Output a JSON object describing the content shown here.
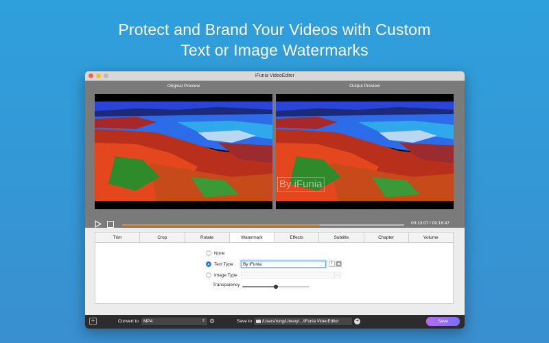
{
  "headline": {
    "line1": "Protect and Brand Your Videos with Custom",
    "line2": "Text or Image Watermarks"
  },
  "window": {
    "title": "iFunia VideoEditor"
  },
  "preview": {
    "original_label": "Original Preview",
    "output_label": "Output Preview",
    "watermark_overlay": "By iFunia",
    "timecode": "00:13:07 / 00:18:47",
    "progress": 0.7
  },
  "tabs": [
    "Trim",
    "Crop",
    "Rotate",
    "Watermark",
    "Effects",
    "Subtitle",
    "Chapter",
    "Volume"
  ],
  "active_tab": "Watermark",
  "watermark": {
    "option_none": "None",
    "option_text": "Text Type",
    "option_image": "Image Type",
    "selected": "Text Type",
    "text_value": "By iFunia",
    "font_btn": "T",
    "transparency_label": "Transparency",
    "transparency_level": 0.5
  },
  "bottom": {
    "convert_label": "Convert to",
    "format": "MP4",
    "save_to_label": "Save to",
    "path": "/Users/rong/Library/.../iFunia VideoEditor",
    "save_button": "Save"
  },
  "icons": {
    "play": "play-icon",
    "stop": "stop-icon",
    "add": "plus-icon",
    "settings": "gear-icon",
    "folder": "folder-icon",
    "go": "arrow-right-icon",
    "font": "text-format-icon",
    "color": "color-box-icon"
  },
  "colors": {
    "background": "#2ea0dc",
    "accent": "#2f7cf6",
    "progress": "#f08a24",
    "save_gradient_start": "#b66cf0",
    "save_gradient_end": "#7a6ff5"
  }
}
